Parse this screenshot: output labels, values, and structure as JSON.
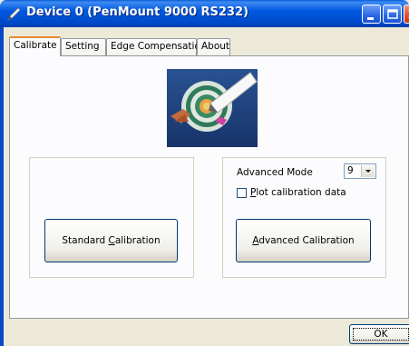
{
  "window": {
    "title": "Device 0 (PenMount 9000 RS232)",
    "title_icon": "pen-icon",
    "controls": [
      "minimize-icon",
      "maximize-icon",
      "close-icon"
    ]
  },
  "tabs": [
    {
      "label": "Calibrate",
      "active": true
    },
    {
      "label": "Setting",
      "active": false
    },
    {
      "label": "Edge Compensation",
      "active": false
    },
    {
      "label": "About",
      "active": false
    }
  ],
  "calibrate": {
    "logo": "target-pen-logo",
    "standard_button": {
      "pre": "Standard ",
      "mnemonic": "C",
      "post": "alibration"
    },
    "advanced_mode_label": "Advanced Mode",
    "advanced_mode_value": "9",
    "plot_checkbox": {
      "mnemonic": "P",
      "post": "lot calibration data",
      "checked": false
    },
    "advanced_button": {
      "mnemonic": "A",
      "post": "dvanced Calibration"
    }
  },
  "footer": {
    "ok_label": "OK"
  },
  "colors": {
    "titlebar": "#0058e0",
    "tab_active_accent": "#e68b2c",
    "dialog_bg": "#ece9d8",
    "panel_bg": "#fcfcfe"
  }
}
